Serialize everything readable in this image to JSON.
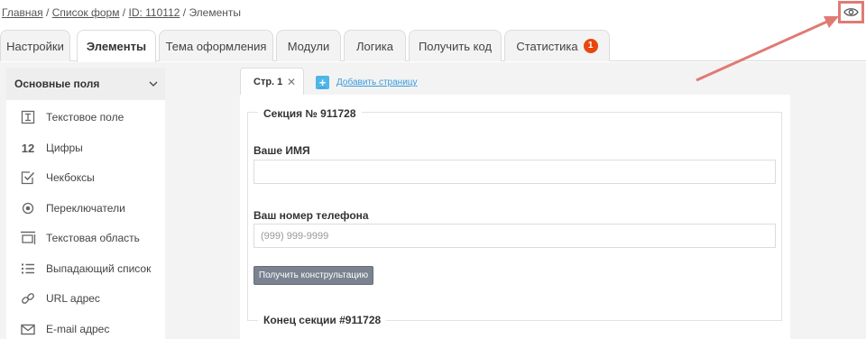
{
  "breadcrumb": {
    "home": "Главная",
    "sep1": "/",
    "forms": "Список форм",
    "sep2": "/",
    "id": "ID: 110112",
    "sep3": "/",
    "current": "Элементы"
  },
  "tabs": [
    {
      "label": "Настройки"
    },
    {
      "label": "Элементы"
    },
    {
      "label": "Тема оформления"
    },
    {
      "label": "Модули"
    },
    {
      "label": "Логика"
    },
    {
      "label": "Получить код"
    },
    {
      "label": "Статистика",
      "badge": "1"
    }
  ],
  "sidebar": {
    "title": "Основные поля",
    "items": [
      {
        "label": "Текстовое поле",
        "icon": "text-field-icon"
      },
      {
        "label": "Цифры",
        "icon": "numbers-icon",
        "glyph": "12"
      },
      {
        "label": "Чекбоксы",
        "icon": "checkbox-icon"
      },
      {
        "label": "Переключатели",
        "icon": "radio-icon"
      },
      {
        "label": "Текстовая область",
        "icon": "textarea-icon"
      },
      {
        "label": "Выпадающий список",
        "icon": "list-icon"
      },
      {
        "label": "URL адрес",
        "icon": "link-icon"
      },
      {
        "label": "E-mail адрес",
        "icon": "mail-icon"
      }
    ]
  },
  "page_tabs": {
    "current": "Стр. 1",
    "add_label": "Добавить страницу"
  },
  "form": {
    "section_title": "Секция № 911728",
    "field1_label": "Ваше ИМЯ",
    "field1_value": "",
    "field2_label": "Ваш номер телефона",
    "field2_placeholder": "(999) 999-9999",
    "submit_label": "Получить констрультацию",
    "section_end": "Конец секции #911728"
  },
  "colors": {
    "badge": "#e8470d",
    "link": "#3a9ad9",
    "highlight": "#e07b73",
    "button": "#7b8290"
  }
}
